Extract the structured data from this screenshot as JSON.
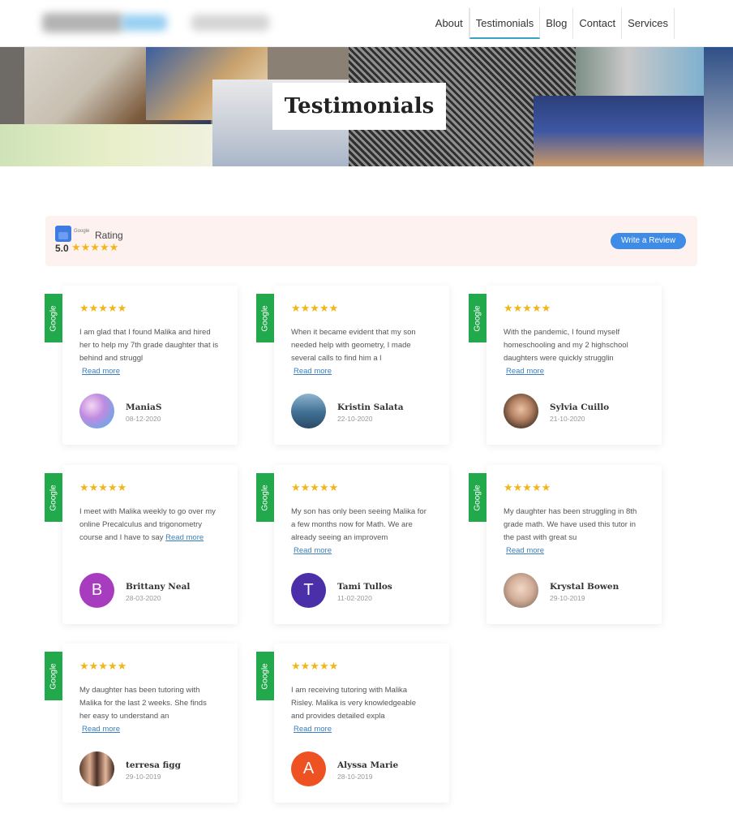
{
  "nav": {
    "items": [
      "About",
      "Testimonials",
      "Blog",
      "Contact",
      "Services"
    ],
    "active": "Testimonials"
  },
  "banner": {
    "title": "Testimonials"
  },
  "rating": {
    "label": "Rating",
    "google_small": "Google",
    "value": "5.0",
    "stars": "★★★★★",
    "write_review": "Write a Review"
  },
  "tab_label": "Google",
  "read_more": "Read more",
  "reviews": [
    {
      "stars": "★★★★★",
      "text": "I am glad that I found Malika and hired her to help my 7th grade daughter that is behind and struggl",
      "name": "ManiaS",
      "date": "08-12-2020",
      "avatar": "photo-purple"
    },
    {
      "stars": "★★★★★",
      "text": "When it became evident that my son needed help with geometry, I made several calls to find him a l",
      "name": "Kristin Salata",
      "date": "22-10-2020",
      "avatar": "photo-car"
    },
    {
      "stars": "★★★★★",
      "text": "With the pandemic, I found myself homeschooling and my 2 highschool daughters were quickly strugglin",
      "name": "Sylvia Cuillo",
      "date": "21-10-2020",
      "avatar": "photo-woman"
    },
    {
      "stars": "★★★★★",
      "text": "I meet with Malika weekly to go over my online Precalculus and trigonometry course and I have to say",
      "name": "Brittany Neal",
      "date": "28-03-2020",
      "avatar": "B",
      "avatar_color": "#a73cbf"
    },
    {
      "stars": "★★★★★",
      "text": "My son has only been seeing Malika for a few months now for Math. We are already seeing an improvem",
      "name": "Tami Tullos",
      "date": "11-02-2020",
      "avatar": "T",
      "avatar_color": "#4a2fa8"
    },
    {
      "stars": "★★★★★",
      "text": "My daughter has been struggling in 8th grade math. We have used this tutor in the past with great su",
      "name": "Krystal Bowen",
      "date": "29-10-2019",
      "avatar": "photo-woman2"
    },
    {
      "stars": "★★★★★",
      "text": "My daughter has been tutoring with Malika for the last 2 weeks. She finds her easy to understand an",
      "name": "terresa figg",
      "date": "29-10-2019",
      "avatar": "photo-pair"
    },
    {
      "stars": "★★★★★",
      "text": "I am receiving tutoring with Malika Risley. Malika is very knowledgeable and provides detailed expla",
      "name": "Alyssa Marie",
      "date": "28-10-2019",
      "avatar": "A",
      "avatar_color": "#ef5222"
    }
  ],
  "colors": {
    "google_tab": "#22a94b",
    "star": "#f3b51a",
    "button": "#3e8ce6",
    "link": "#3a7fbf"
  }
}
